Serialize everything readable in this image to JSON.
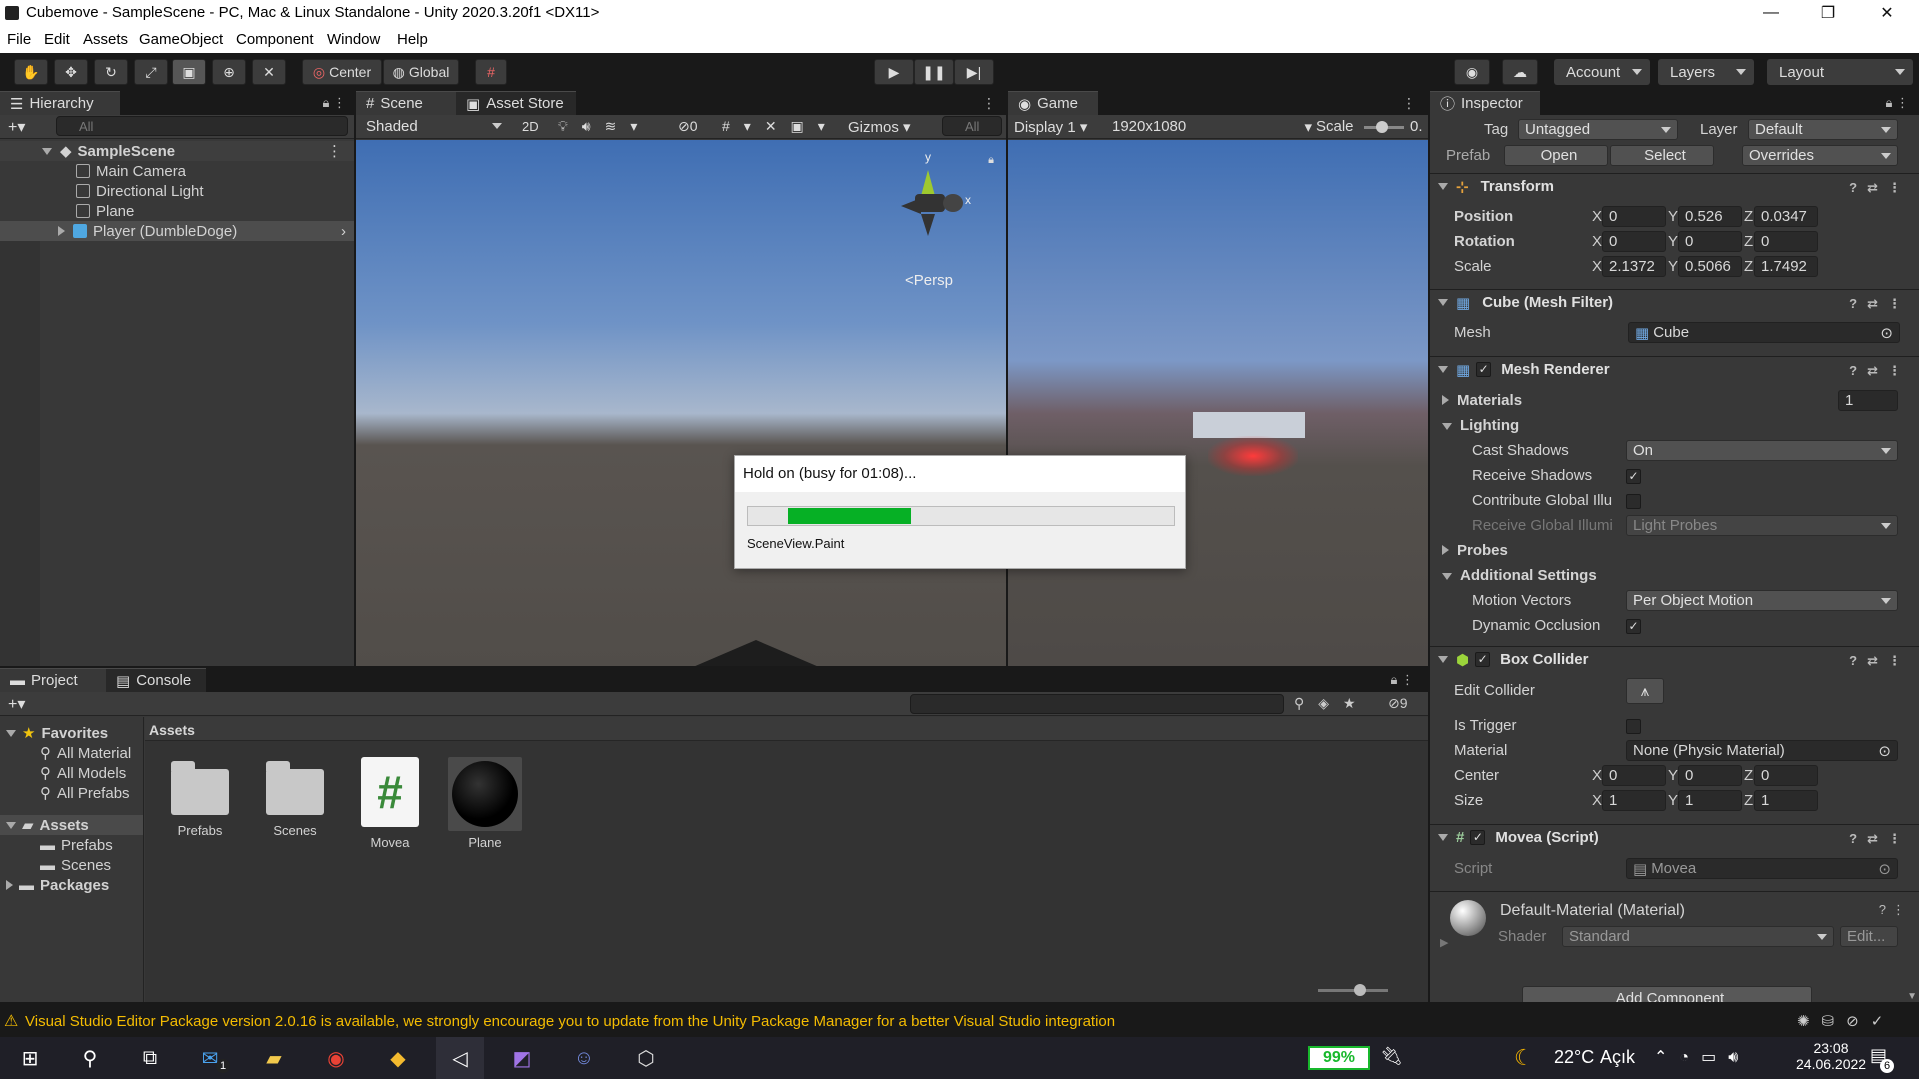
{
  "window": {
    "title": "Cubemove - SampleScene - PC, Mac & Linux Standalone - Unity 2020.3.20f1 <DX11>",
    "minimize": "—",
    "maximize": "❐",
    "close": "✕"
  },
  "menu": [
    "File",
    "Edit",
    "Assets",
    "GameObject",
    "Component",
    "Window",
    "Help"
  ],
  "toolbar": {
    "pivot": "Center",
    "space": "Global",
    "account": "Account",
    "layers": "Layers",
    "layout": "Layout"
  },
  "hierarchy": {
    "tab": "Hierarchy",
    "search_placeholder": "All",
    "scene": "SampleScene",
    "items": [
      "Main Camera",
      "Directional Light",
      "Plane",
      "Player (DumbleDoge)"
    ]
  },
  "scene": {
    "tabs": [
      "Scene",
      "Asset Store"
    ],
    "shading": "Shaded",
    "mode2d": "2D",
    "hidden_count": "0",
    "gizmos": "Gizmos",
    "search_placeholder": "All",
    "gizmo_y": "y",
    "gizmo_x": "x",
    "persp": "<Persp"
  },
  "game": {
    "tab": "Game",
    "display": "Display 1",
    "resolution": "1920x1080",
    "scale_label": "Scale",
    "scale_value": "0."
  },
  "dialog": {
    "title": "Hold on (busy for 01:08)...",
    "progress": 0.3,
    "status": "SceneView.Paint"
  },
  "inspector": {
    "tab": "Inspector",
    "tag_label": "Tag",
    "tag": "Untagged",
    "layer_label": "Layer",
    "layer": "Default",
    "prefab_label": "Prefab",
    "prefab_open": "Open",
    "prefab_select": "Select",
    "prefab_overrides": "Overrides",
    "transform": {
      "title": "Transform",
      "position_label": "Position",
      "position": [
        "0",
        "0.526",
        "0.0347"
      ],
      "rotation_label": "Rotation",
      "rotation": [
        "0",
        "0",
        "0"
      ],
      "scale_label": "Scale",
      "scale": [
        "2.1372",
        "0.5066",
        "1.7492"
      ]
    },
    "mesh_filter": {
      "title": "Cube (Mesh Filter)",
      "mesh_label": "Mesh",
      "mesh": "Cube"
    },
    "mesh_renderer": {
      "title": "Mesh Renderer",
      "materials_label": "Materials",
      "materials_count": "1",
      "lighting_label": "Lighting",
      "cast_shadows_label": "Cast Shadows",
      "cast_shadows": "On",
      "receive_shadows_label": "Receive Shadows",
      "contribute_gi_label": "Contribute Global Illu",
      "receive_gi_label": "Receive Global Illumi",
      "receive_gi": "Light Probes",
      "probes_label": "Probes",
      "additional_label": "Additional Settings",
      "motion_vectors_label": "Motion Vectors",
      "motion_vectors": "Per Object Motion",
      "dynamic_occlusion_label": "Dynamic Occlusion"
    },
    "box_collider": {
      "title": "Box Collider",
      "edit_label": "Edit Collider",
      "trigger_label": "Is Trigger",
      "material_label": "Material",
      "material": "None (Physic Material)",
      "center_label": "Center",
      "center": [
        "0",
        "0",
        "0"
      ],
      "size_label": "Size",
      "size": [
        "1",
        "1",
        "1"
      ]
    },
    "script": {
      "title": "Movea (Script)",
      "script_label": "Script",
      "script": "Movea"
    },
    "material": {
      "title": "Default-Material (Material)",
      "shader_label": "Shader",
      "shader": "Standard",
      "edit": "Edit..."
    },
    "add_component": "Add Component",
    "axes": [
      "X",
      "Y",
      "Z"
    ]
  },
  "project": {
    "tabs": [
      "Project",
      "Console"
    ],
    "hidden_count": "9",
    "favorites": "Favorites",
    "fav_items": [
      "All Material",
      "All Models",
      "All Prefabs"
    ],
    "assets_root": "Assets",
    "asset_folders": [
      "Prefabs",
      "Scenes"
    ],
    "packages": "Packages",
    "breadcrumb": "Assets",
    "assets": [
      "Prefabs",
      "Scenes",
      "Movea",
      "Plane"
    ]
  },
  "statusbar": {
    "message": "Visual Studio Editor Package version 2.0.16 is available, we strongly encourage you to update from the Unity Package Manager for a better Visual Studio integration"
  },
  "taskbar": {
    "battery": "99%",
    "temperature": "22°C",
    "weather": "Açık",
    "time": "23:08",
    "date": "24.06.2022",
    "notifications": "6",
    "mail_badge": "1"
  },
  "colors": {
    "accent_green": "#18b82c",
    "warning": "#f4bc02",
    "unity_blue": "#4fa8e2"
  }
}
